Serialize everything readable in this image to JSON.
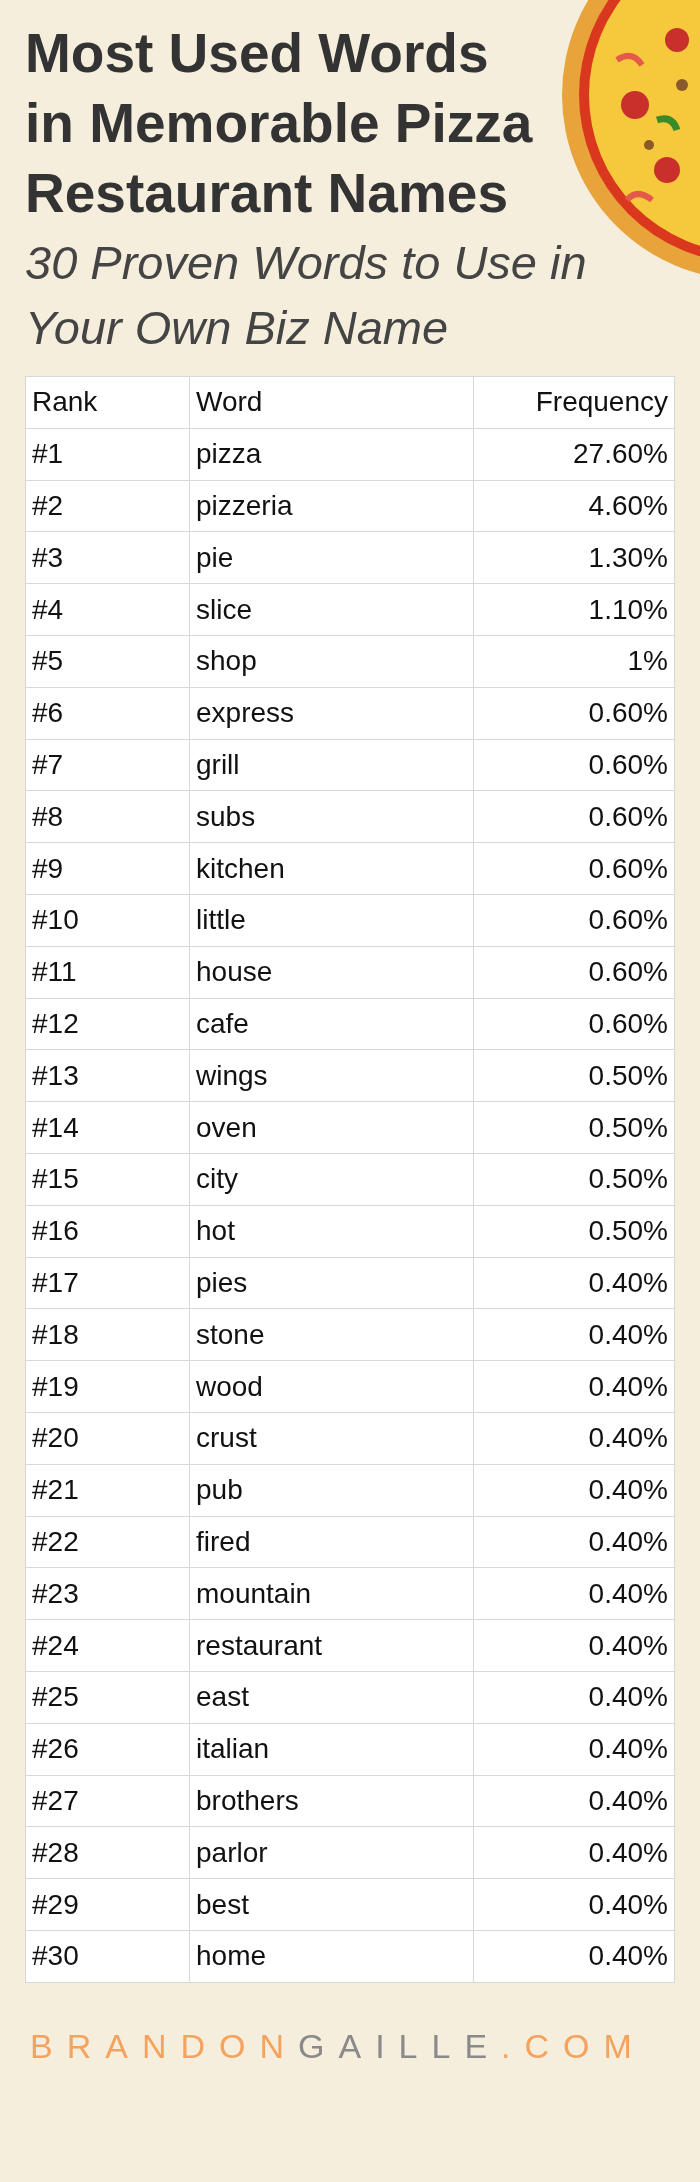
{
  "title": "Most Used Words in Memorable Pizza Restaurant Names",
  "subtitle": "30 Proven Words to Use in Your Own Biz Name",
  "table": {
    "columns": [
      "Rank",
      "Word",
      "Frequency"
    ],
    "rows": [
      [
        "#1",
        "pizza",
        "27.60%"
      ],
      [
        "#2",
        "pizzeria",
        "4.60%"
      ],
      [
        "#3",
        "pie",
        "1.30%"
      ],
      [
        "#4",
        "slice",
        "1.10%"
      ],
      [
        "#5",
        "shop",
        "1%"
      ],
      [
        "#6",
        "express",
        "0.60%"
      ],
      [
        "#7",
        "grill",
        "0.60%"
      ],
      [
        "#8",
        "subs",
        "0.60%"
      ],
      [
        "#9",
        "kitchen",
        "0.60%"
      ],
      [
        "#10",
        "little",
        "0.60%"
      ],
      [
        "#11",
        "house",
        "0.60%"
      ],
      [
        "#12",
        "cafe",
        "0.60%"
      ],
      [
        "#13",
        "wings",
        "0.50%"
      ],
      [
        "#14",
        "oven",
        "0.50%"
      ],
      [
        "#15",
        "city",
        "0.50%"
      ],
      [
        "#16",
        "hot",
        "0.50%"
      ],
      [
        "#17",
        "pies",
        "0.40%"
      ],
      [
        "#18",
        "stone",
        "0.40%"
      ],
      [
        "#19",
        "wood",
        "0.40%"
      ],
      [
        "#20",
        "crust",
        "0.40%"
      ],
      [
        "#21",
        "pub",
        "0.40%"
      ],
      [
        "#22",
        "fired",
        "0.40%"
      ],
      [
        "#23",
        "mountain",
        "0.40%"
      ],
      [
        "#24",
        "restaurant",
        "0.40%"
      ],
      [
        "#25",
        "east",
        "0.40%"
      ],
      [
        "#26",
        "italian",
        "0.40%"
      ],
      [
        "#27",
        "brothers",
        "0.40%"
      ],
      [
        "#28",
        "parlor",
        "0.40%"
      ],
      [
        "#29",
        "best",
        "0.40%"
      ],
      [
        "#30",
        "home",
        "0.40%"
      ]
    ]
  },
  "footer": [
    {
      "text": "BRANDON",
      "color": "#f4a35e"
    },
    {
      "text": "GAILLE",
      "color": "#8a8a8a"
    },
    {
      "text": ".COM",
      "color": "#f4a35e"
    }
  ]
}
